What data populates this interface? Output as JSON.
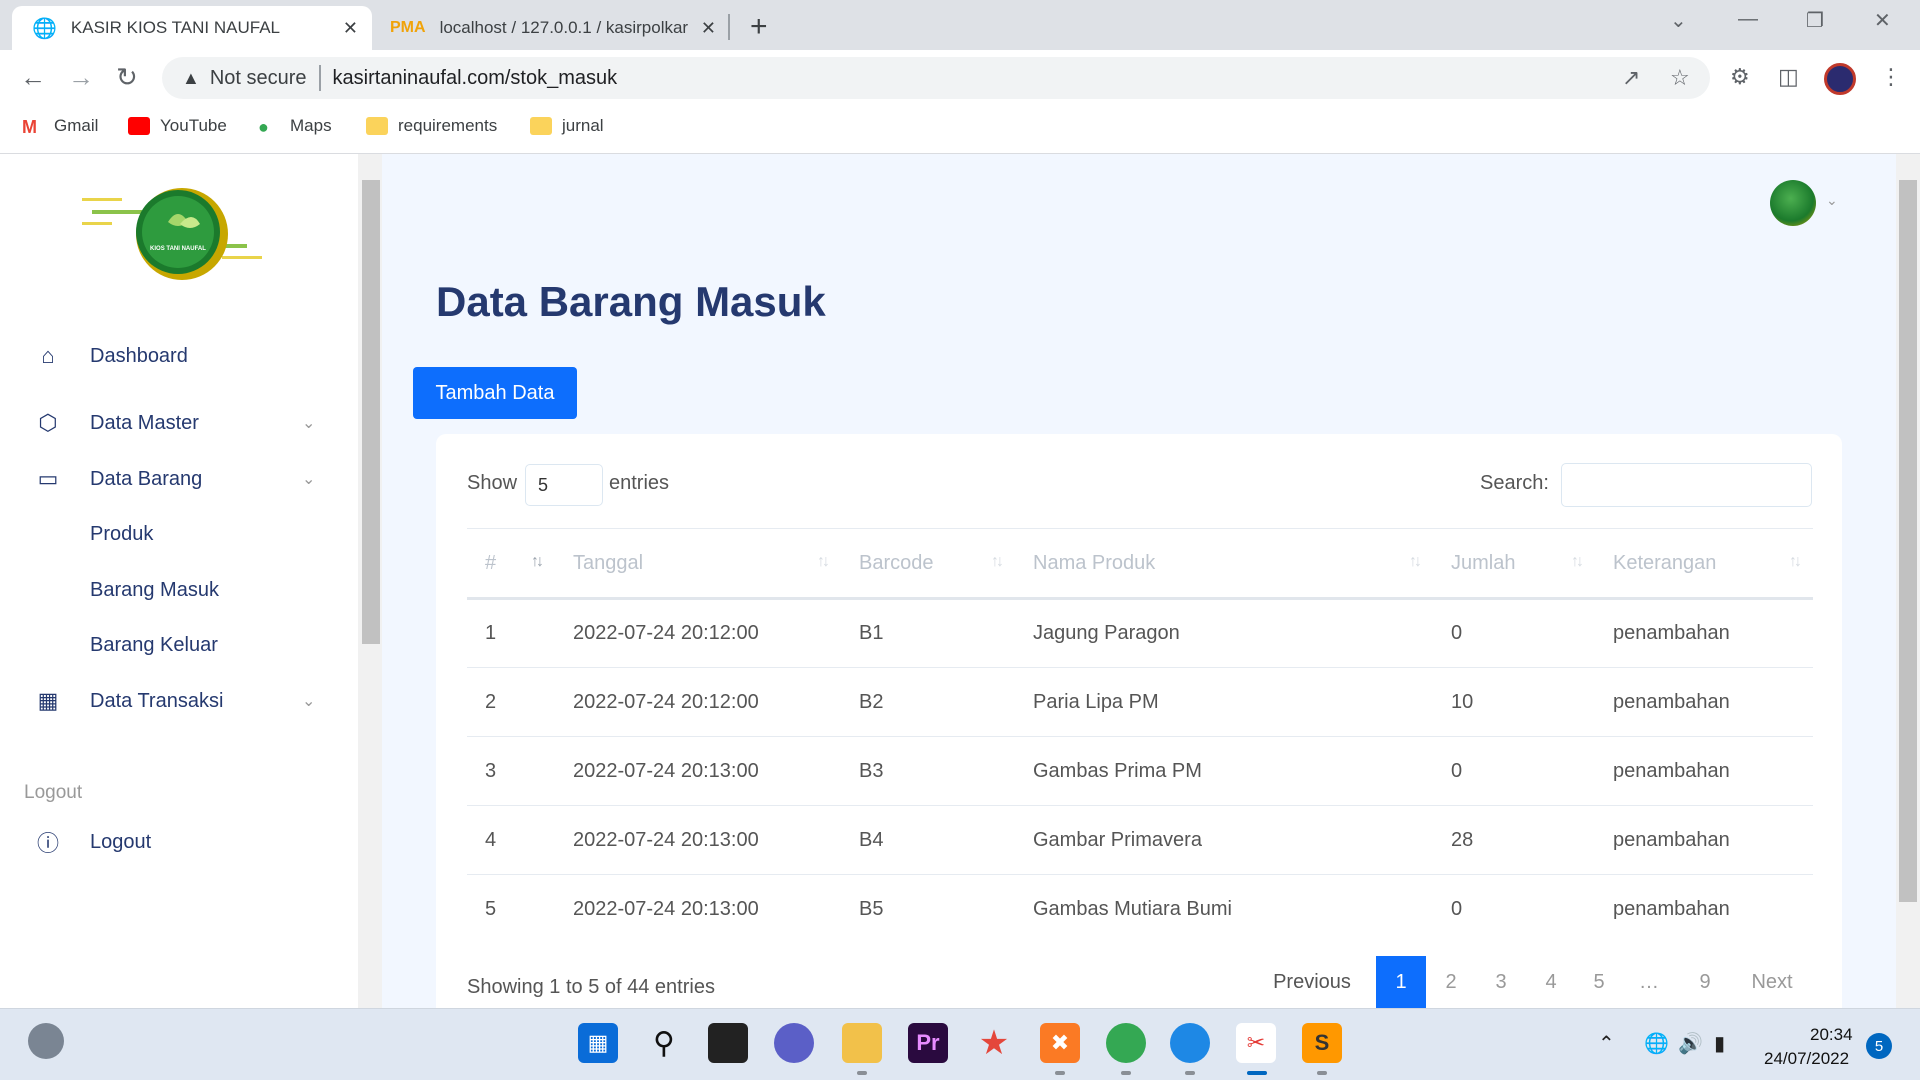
{
  "browser": {
    "tabs": [
      {
        "title": "KASIR KIOS TANI NAUFAL",
        "active": true,
        "icon": "globe-icon"
      },
      {
        "title": "localhost / 127.0.0.1 / kasirpolkar",
        "active": false,
        "icon": "phpmyadmin-icon"
      }
    ],
    "address": {
      "security_label": "Not secure",
      "url": "kasirtaninaufal.com/stok_masuk"
    },
    "bookmarks": [
      {
        "label": "Gmail",
        "icon": "gmail-icon"
      },
      {
        "label": "YouTube",
        "icon": "youtube-icon"
      },
      {
        "label": "Maps",
        "icon": "maps-icon"
      },
      {
        "label": "requirements",
        "icon": "folder-icon"
      },
      {
        "label": "jurnal",
        "icon": "folder-icon"
      }
    ]
  },
  "sidebar": {
    "logo_text": "KIOS TANI NAUFAL",
    "items": [
      {
        "label": "Dashboard",
        "icon": "home-icon"
      },
      {
        "label": "Data Master",
        "icon": "box-icon",
        "expandable": true
      },
      {
        "label": "Data Barang",
        "icon": "card-icon",
        "expandable": true
      },
      {
        "label": "Produk"
      },
      {
        "label": "Barang Masuk"
      },
      {
        "label": "Barang Keluar"
      },
      {
        "label": "Data Transaksi",
        "icon": "grid-icon",
        "expandable": true
      }
    ],
    "section_title": "Logout",
    "logout": {
      "label": "Logout",
      "icon": "question-circle-icon"
    }
  },
  "main": {
    "title": "Data Barang Masuk",
    "add_button": "Tambah Data",
    "table_controls": {
      "show_label": "Show",
      "entries_value": "5",
      "entries_label": "entries",
      "search_label": "Search:"
    },
    "columns": [
      "#",
      "Tanggal",
      "Barcode",
      "Nama Produk",
      "Jumlah",
      "Keterangan"
    ],
    "rows": [
      [
        "1",
        "2022-07-24 20:12:00",
        "B1",
        "Jagung Paragon",
        "0",
        "penambahan"
      ],
      [
        "2",
        "2022-07-24 20:12:00",
        "B2",
        "Paria Lipa PM",
        "10",
        "penambahan"
      ],
      [
        "3",
        "2022-07-24 20:13:00",
        "B3",
        "Gambas Prima PM",
        "0",
        "penambahan"
      ],
      [
        "4",
        "2022-07-24 20:13:00",
        "B4",
        "Gambar Primavera",
        "28",
        "penambahan"
      ],
      [
        "5",
        "2022-07-24 20:13:00",
        "B5",
        "Gambas Mutiara Bumi",
        "0",
        "penambahan"
      ]
    ],
    "info": "Showing 1 to 5 of 44 entries",
    "pagination": [
      "Previous",
      "1",
      "2",
      "3",
      "4",
      "5",
      "…",
      "9",
      "Next"
    ],
    "current_page": "1"
  },
  "taskbar": {
    "time": "20:34",
    "date": "24/07/2022",
    "notifications": "5"
  },
  "colors": {
    "primary": "#0d6efd",
    "sidebar_text": "#25396f",
    "page_bg": "#f2f7ff"
  }
}
